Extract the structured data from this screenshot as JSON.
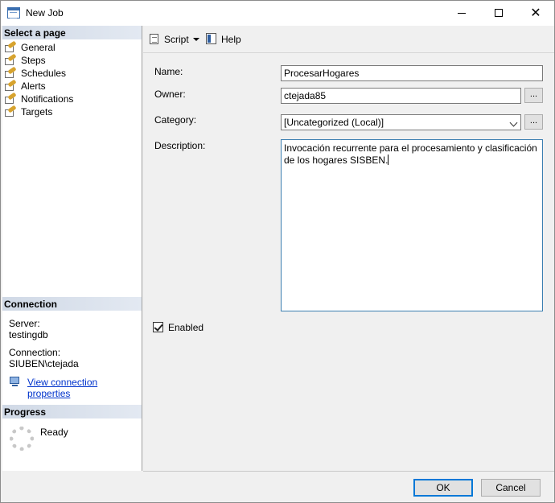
{
  "window": {
    "title": "New Job",
    "controls": {
      "minimize": "minimize-icon",
      "maximize": "maximize-icon",
      "close": "✕"
    }
  },
  "sidebar": {
    "select_header": "Select a page",
    "pages": [
      {
        "label": "General",
        "icon": "page-wrench-icon"
      },
      {
        "label": "Steps",
        "icon": "page-wrench-icon"
      },
      {
        "label": "Schedules",
        "icon": "page-wrench-icon"
      },
      {
        "label": "Alerts",
        "icon": "page-wrench-icon"
      },
      {
        "label": "Notifications",
        "icon": "page-wrench-icon"
      },
      {
        "label": "Targets",
        "icon": "page-wrench-icon"
      }
    ],
    "connection": {
      "header": "Connection",
      "server_label": "Server:",
      "server_value": "testingdb",
      "connection_label": "Connection:",
      "connection_value": "SIUBEN\\ctejada",
      "link_text": "View connection properties"
    },
    "progress": {
      "header": "Progress",
      "status": "Ready"
    }
  },
  "toolbar": {
    "script_label": "Script",
    "help_label": "Help"
  },
  "form": {
    "name_label": "Name:",
    "name_value": "ProcesarHogares",
    "owner_label": "Owner:",
    "owner_value": "ctejada85",
    "category_label": "Category:",
    "category_value": "[Uncategorized (Local)]",
    "description_label": "Description:",
    "description_value": "Invocación recurrente para el procesamiento y clasificación de los hogares SISBEN.",
    "browse_label": "...",
    "enabled_label": "Enabled",
    "enabled_checked": true
  },
  "buttons": {
    "ok": "OK",
    "cancel": "Cancel"
  },
  "colors": {
    "accent": "#0078d7",
    "link": "#0033cc",
    "section_header": "#d0d9e6"
  }
}
